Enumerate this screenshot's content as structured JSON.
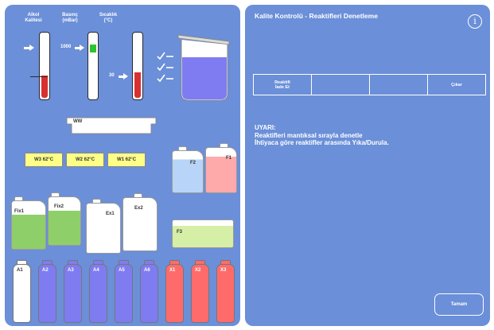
{
  "gauges": {
    "alcohol_label": "Alkol\nKalitesi",
    "pressure_label": "Basınç\n(mBar)",
    "temp_label": "Sıcaklık\n(°C)",
    "pressure_value": "1000",
    "temp_value": "30"
  },
  "station": {
    "ww_label": "WW"
  },
  "baths": [
    {
      "label": "W3  62°C"
    },
    {
      "label": "W2  62°C"
    },
    {
      "label": "W1  62°C"
    }
  ],
  "jugs": {
    "f2": "F2",
    "f1": "F1",
    "fix1": "Fix1",
    "fix2": "Fix2",
    "ex1": "Ex1",
    "ex2": "Ex2",
    "f3": "F3"
  },
  "bottles": [
    {
      "label": "A1",
      "color": "#ffffff"
    },
    {
      "label": "A2",
      "color": "#7f7cf2"
    },
    {
      "label": "A3",
      "color": "#7f7cf2"
    },
    {
      "label": "A4",
      "color": "#7f7cf2"
    },
    {
      "label": "A5",
      "color": "#7f7cf2"
    },
    {
      "label": "A6",
      "color": "#7f7cf2"
    },
    {
      "label": "X1",
      "color": "#ff6b6b"
    },
    {
      "label": "X2",
      "color": "#ff6b6b"
    },
    {
      "label": "X3",
      "color": "#ff6b6b"
    }
  ],
  "dialog": {
    "title": "Kalite Kontrolü - Reaktifleri Denetleme",
    "tabs": [
      "Reaktifi\nİade Et",
      "",
      "",
      "Çıkar"
    ],
    "warning_title": "UYARI:",
    "warning_line1": "Reaktifleri mantıksal sırayla denetle",
    "warning_line2": "İhtiyaca göre reaktifler arasında Yıka/Durula.",
    "ok_label": "Tamam"
  },
  "colors": {
    "panel": "#6b8fd8",
    "reagent_blue": "#7f7cf2",
    "xylene_red": "#ff6b6b",
    "fix_green": "#8fcf6a",
    "bath_yellow": "#ffff88"
  }
}
